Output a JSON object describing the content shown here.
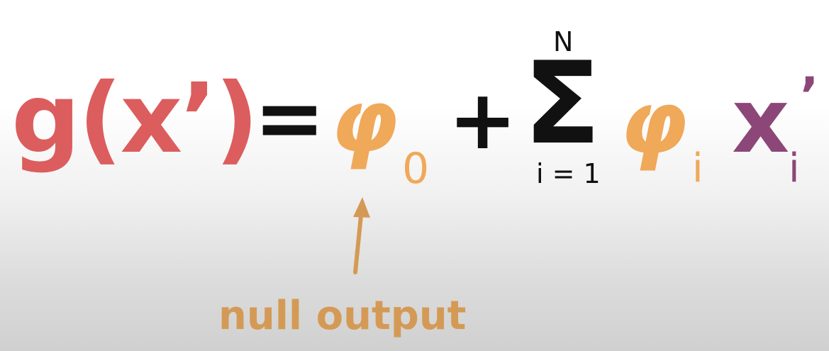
{
  "equation": {
    "lhs": "g(x’)",
    "equals": "=",
    "phi_zero": "φ",
    "phi_zero_subscript": "0",
    "plus": "+",
    "sum_symbol": "Σ",
    "sum_upper": "N",
    "sum_lower": "i = 1",
    "phi_i": "φ",
    "phi_i_subscript": "i",
    "x": "x",
    "x_prime": "’",
    "x_subscript": "i"
  },
  "annotation": {
    "label": "null output"
  },
  "colors": {
    "lhs": "#dc5d5d",
    "phi": "#f0a859",
    "operator": "#111111",
    "x_var": "#8c4778",
    "annotation": "#d49a55"
  }
}
